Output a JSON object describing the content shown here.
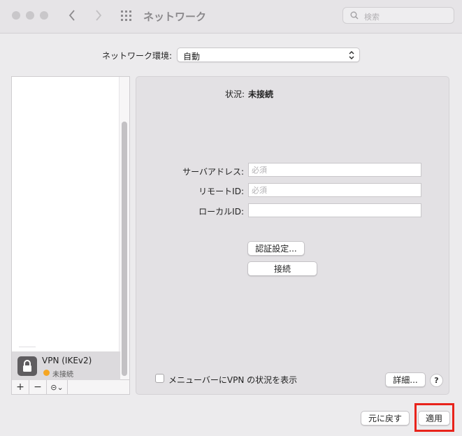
{
  "window": {
    "title": "ネットワーク"
  },
  "search": {
    "placeholder": "検索"
  },
  "location": {
    "label": "ネットワーク環境:",
    "value": "自動"
  },
  "services": [
    {
      "name": "VPN (IKEv2)",
      "status": "未接続",
      "status_color": "#f5a623"
    }
  ],
  "sidebar_toolbar": {
    "add": "+",
    "remove": "−",
    "action": "⊝⌄"
  },
  "detail": {
    "status_label": "状況:",
    "status_value": "未接続",
    "server_label": "サーバアドレス:",
    "server_placeholder": "必須",
    "remote_id_label": "リモートID:",
    "remote_id_placeholder": "必須",
    "local_id_label": "ローカルID:",
    "local_id_value": "",
    "auth_button": "認証設定...",
    "connect_button": "接続",
    "show_in_menubar_label": "メニューバーにVPN の状況を表示",
    "show_in_menubar_checked": false,
    "advanced_button": "詳細...",
    "help_button": "?"
  },
  "footer": {
    "revert_button": "元に戻す",
    "apply_button": "適用"
  },
  "colors": {
    "highlight": "#e8231b",
    "status_pending": "#f5a623"
  }
}
